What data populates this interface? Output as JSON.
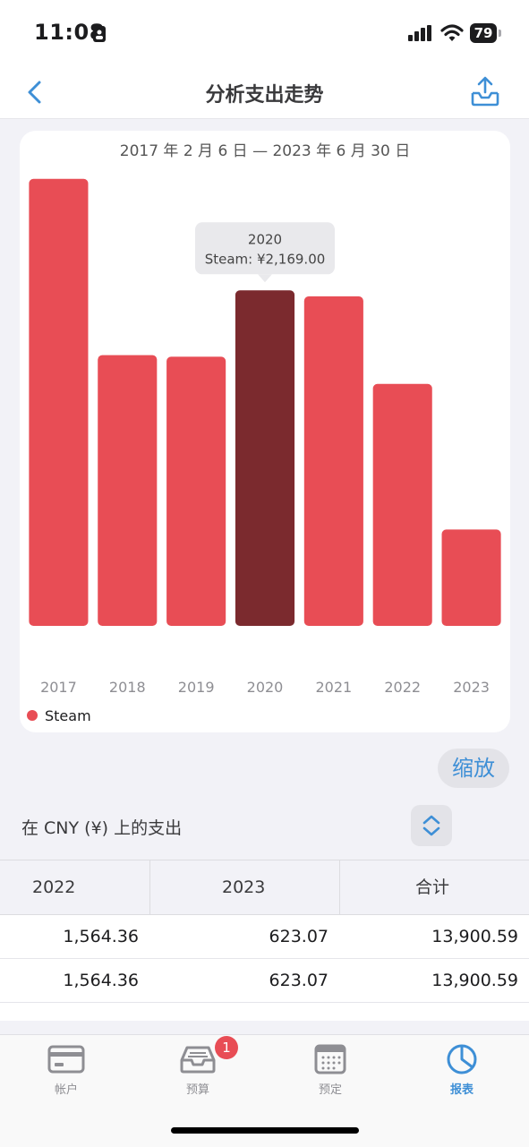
{
  "status_bar": {
    "time": "11:08",
    "battery": "79"
  },
  "nav": {
    "title": "分析支出走势"
  },
  "chart": {
    "date_range": "2017 年 2 月 6 日 — 2023 年 6 月 30 日",
    "tooltip": {
      "title": "2020",
      "text": "Steam: ¥2,169.00"
    },
    "legend": "Steam",
    "colors": {
      "bar": "#e84d55",
      "selected": "#7b2a2e"
    }
  },
  "chart_data": {
    "type": "bar",
    "categories": [
      "2017",
      "2018",
      "2019",
      "2020",
      "2021",
      "2022",
      "2023"
    ],
    "series": [
      {
        "name": "Steam",
        "values": [
          2890,
          1750,
          1740,
          2169,
          2130,
          1564.36,
          623.07
        ]
      }
    ],
    "selected_index": 3,
    "ylim": [
      0,
      2900
    ],
    "grid": false,
    "legend": "bottom-left"
  },
  "zoom_label": "缩放",
  "section_label": "在 CNY (¥) 上的支出",
  "table": {
    "headers": [
      "2022",
      "2023",
      "合计"
    ],
    "rows": [
      [
        "1,564.36",
        "623.07",
        "13,900.59"
      ],
      [
        "1,564.36",
        "623.07",
        "13,900.59"
      ]
    ]
  },
  "tabs": [
    {
      "label": "帐户",
      "icon": "credit-card-icon"
    },
    {
      "label": "预算",
      "icon": "inbox-tray-icon",
      "badge": "1"
    },
    {
      "label": "预定",
      "icon": "calendar-icon"
    },
    {
      "label": "报表",
      "icon": "pie-chart-icon",
      "active": true
    }
  ]
}
